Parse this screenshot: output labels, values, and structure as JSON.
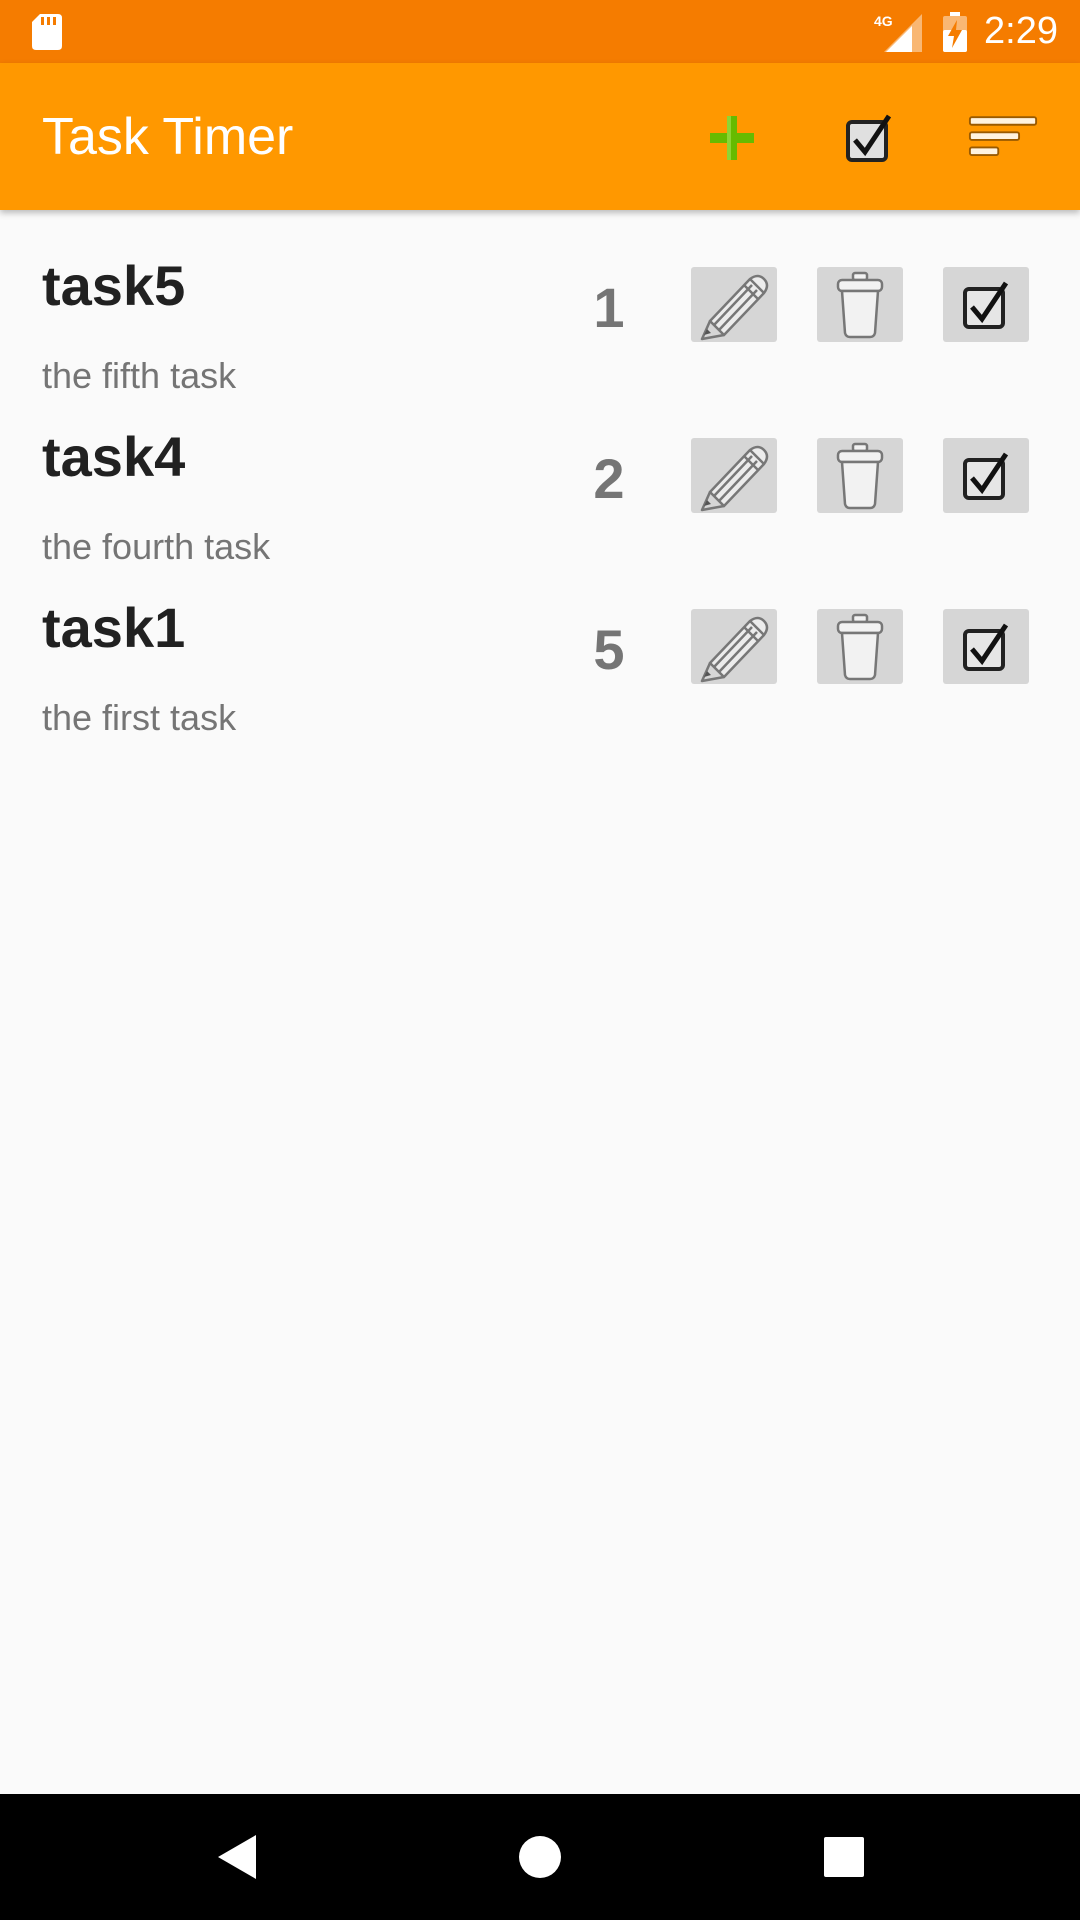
{
  "status_bar": {
    "time": "2:29",
    "network": "4G",
    "icons": [
      "sd-card-icon",
      "cell-signal-icon",
      "battery-charging-icon"
    ]
  },
  "app_bar": {
    "title": "Task Timer",
    "actions": [
      {
        "name": "add-task",
        "icon": "plus-icon"
      },
      {
        "name": "show-durations",
        "icon": "checkbox-icon"
      },
      {
        "name": "sort-menu",
        "icon": "sort-lines-icon"
      }
    ],
    "colors": {
      "app_bar": "#ff9800",
      "status_bar": "#f57c00",
      "plus": "#66bb00"
    }
  },
  "tasks": [
    {
      "name": "task5",
      "description": "the fifth task",
      "order": "1"
    },
    {
      "name": "task4",
      "description": "the fourth task",
      "order": "2"
    },
    {
      "name": "task1",
      "description": "the first task",
      "order": "5"
    }
  ],
  "row_actions": [
    "pencil-icon",
    "trash-icon",
    "checkbox-icon"
  ],
  "nav_bar": {
    "buttons": [
      "back-icon",
      "home-icon",
      "recents-icon"
    ]
  }
}
